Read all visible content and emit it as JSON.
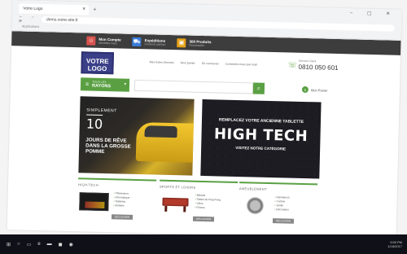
{
  "browser": {
    "tab_title": "Votre Logo",
    "url": "demo.votre-site.fr",
    "bookmarks": "Applications",
    "new_tab": "+",
    "window_controls": "– ▢ ✕"
  },
  "topbar": {
    "items": [
      {
        "title": "Mon Compte",
        "sub": "Identifiez-vous",
        "color": "#d9534f",
        "icon": "user-icon"
      },
      {
        "title": "Expéditions",
        "sub": "Livraison partout",
        "color": "#3b7dd8",
        "icon": "truck-icon"
      },
      {
        "title": "300 Produits",
        "sub": "Nouveautés",
        "color": "#e6a117",
        "icon": "box-icon"
      }
    ]
  },
  "header": {
    "logo_line1": "VOTRE",
    "logo_line2": "LOGO",
    "links": [
      "Mes listes d'envies",
      "Mon panier",
      "Se connecter",
      "Contactez-nous par mail"
    ],
    "phone_label": "Service Client",
    "phone_number": "0810 050 601"
  },
  "searchbar": {
    "rayons_small": "TOUS LES",
    "rayons_big": "RAYONS",
    "placeholder": "",
    "cart_label": "Mon Panier",
    "cart_count": "0"
  },
  "banner1": {
    "small": "SIMPLEMENT",
    "number": "10",
    "text": "JOURS DE RÊVE DANS LA GROSSE POMME"
  },
  "banner2": {
    "top": "REMPLACEZ VOTRE ANCIENNE TABLETTE",
    "headline": "HIGH TECH",
    "bottom": "VISITEZ NOTRE CATÉGORIE"
  },
  "categories": [
    {
      "title": "HIGH-TECH",
      "items": [
        "Téléviseurs",
        "Informatique",
        "Tablettes",
        "Mobiles"
      ],
      "button": "DÉCOUVRIR"
    },
    {
      "title": "SPORTS ET LOISIRS",
      "items": [
        "Billards",
        "Tables de Ping-Pong",
        "Vélos",
        "Fitness"
      ],
      "button": "DÉCOUVRIR"
    },
    {
      "title": "AMEUBLEMENT",
      "items": [
        "Aspirateurs",
        "Cuisine",
        "Jardin",
        "Décoration"
      ],
      "button": "DÉCOUVRIR"
    }
  ],
  "taskbar": {
    "clock_time": "3:55 PM",
    "clock_date": "1/18/2017"
  }
}
